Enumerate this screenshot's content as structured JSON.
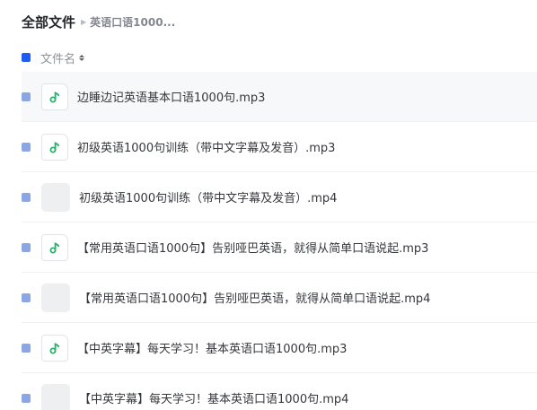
{
  "breadcrumb": {
    "root": "全部文件",
    "current": "英语口语1000..."
  },
  "list_header": {
    "name_column": "文件名"
  },
  "colors": {
    "accent": "#1f5cf0",
    "audio_icon_green": "#27b06a"
  },
  "files": [
    {
      "name": "边睡边记英语基本口语1000句.mp3",
      "type": "audio",
      "icon": "music-note-icon"
    },
    {
      "name": "初级英语1000句训练（带中文字幕及发音）.mp3",
      "type": "audio",
      "icon": "music-note-icon"
    },
    {
      "name": "初级英语1000句训练（带中文字幕及发音）.mp4",
      "type": "video",
      "icon": "video-thumbnail-icon"
    },
    {
      "name": "【常用英语口语1000句】告别哑巴英语，就得从简单口语说起.mp3",
      "type": "audio",
      "icon": "music-note-icon"
    },
    {
      "name": "【常用英语口语1000句】告别哑巴英语，就得从简单口语说起.mp4",
      "type": "video",
      "icon": "video-thumbnail-icon"
    },
    {
      "name": "【中英字幕】每天学习！基本英语口语1000句.mp3",
      "type": "audio",
      "icon": "music-note-icon"
    },
    {
      "name": "【中英字幕】每天学习！基本英语口语1000句.mp4",
      "type": "video",
      "icon": "video-thumbnail-icon"
    }
  ]
}
